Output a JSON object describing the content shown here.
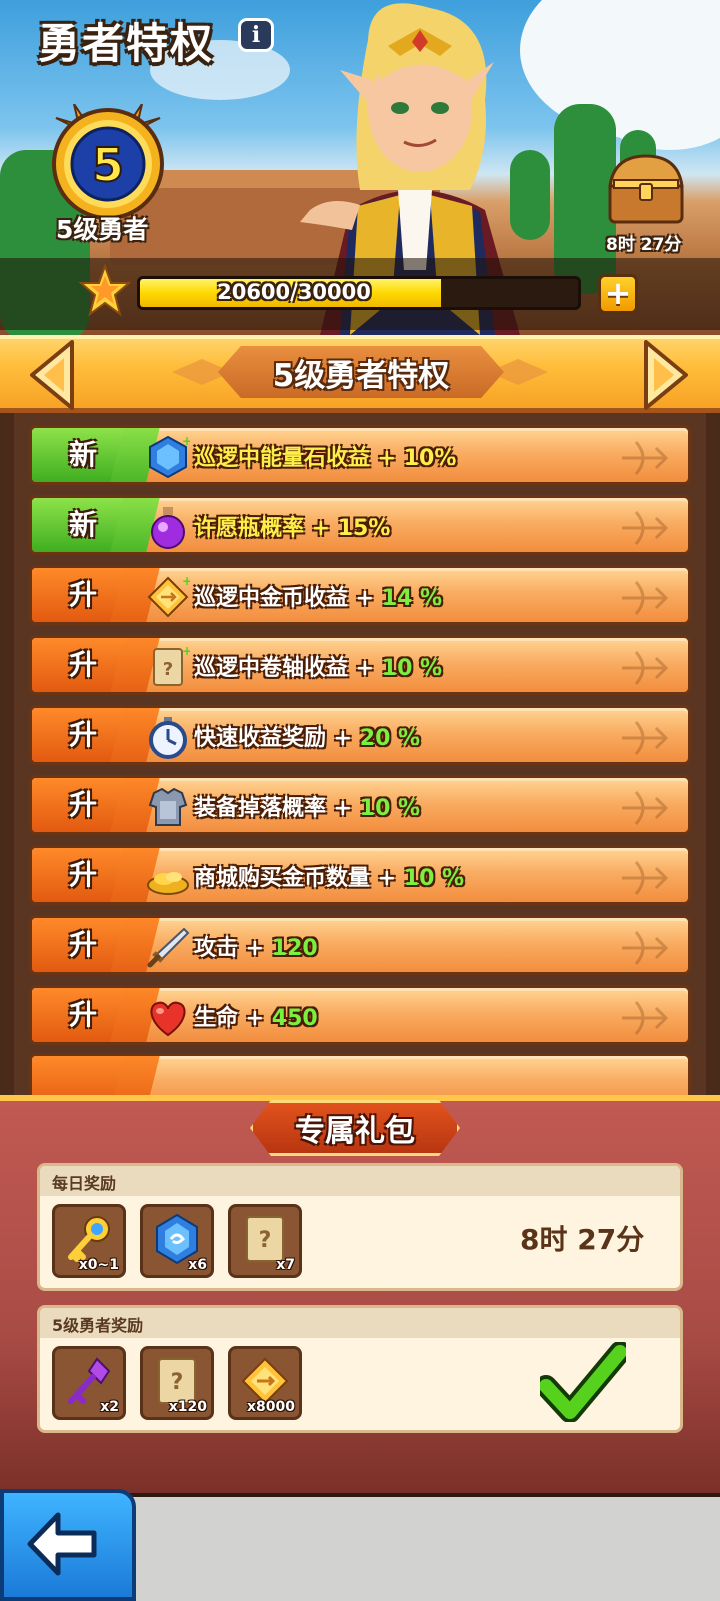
{
  "header": {
    "title": "勇者特权",
    "info_icon": "info-icon",
    "level_number": "5",
    "level_caption": "5级勇者",
    "chest_timer": "8时 27分",
    "xp_text": "20600/30000",
    "xp_current": 20600,
    "xp_max": 30000,
    "plus_label": "+"
  },
  "banner": {
    "title": "5级勇者特权",
    "left_arrow_icon": "arrow-left-icon",
    "right_arrow_icon": "arrow-right-icon"
  },
  "privileges": [
    {
      "tag": "新",
      "kind": "new",
      "icon": "energy-stone-icon",
      "text": "巡逻中能量石收益 + 10%",
      "value": ""
    },
    {
      "tag": "新",
      "kind": "new",
      "icon": "wish-bottle-icon",
      "text": "许愿瓶概率 + 15%",
      "value": ""
    },
    {
      "tag": "升",
      "kind": "up",
      "icon": "gold-coin-icon",
      "text": "巡逻中金币收益 + ",
      "value": "14 %"
    },
    {
      "tag": "升",
      "kind": "up",
      "icon": "scroll-icon",
      "text": "巡逻中卷轴收益 + ",
      "value": "10 %"
    },
    {
      "tag": "升",
      "kind": "up",
      "icon": "stopwatch-icon",
      "text": "快速收益奖励 + ",
      "value": "20 %"
    },
    {
      "tag": "升",
      "kind": "up",
      "icon": "armor-icon",
      "text": "装备掉落概率 + ",
      "value": "10 %"
    },
    {
      "tag": "升",
      "kind": "up",
      "icon": "gold-pile-icon",
      "text": "商城购买金币数量 + ",
      "value": "10 %"
    },
    {
      "tag": "升",
      "kind": "up",
      "icon": "sword-icon",
      "text": "攻击 + ",
      "value": "120"
    },
    {
      "tag": "升",
      "kind": "up",
      "icon": "heart-icon",
      "text": "生命 + ",
      "value": "450"
    }
  ],
  "gift": {
    "title": "专属礼包",
    "daily": {
      "label": "每日奖励",
      "timer": "8时 27分",
      "items": [
        {
          "icon": "gold-key-icon",
          "count": "x0~1"
        },
        {
          "icon": "energy-stone-icon",
          "count": "x6"
        },
        {
          "icon": "scroll-icon",
          "count": "x7"
        }
      ]
    },
    "level": {
      "label": "5级勇者奖励",
      "claimed_icon": "checkmark-icon",
      "items": [
        {
          "icon": "purple-key-icon",
          "count": "x2"
        },
        {
          "icon": "scroll-icon",
          "count": "x120"
        },
        {
          "icon": "gold-coin-icon",
          "count": "x8000"
        }
      ]
    }
  },
  "nav": {
    "back_icon": "back-arrow-icon"
  },
  "colors": {
    "banner": "#ffbd3a",
    "row_new": "#3fae20",
    "row_up": "#e25a10",
    "value_green": "#7cf040",
    "gift_bg": "#a94b45",
    "back_button": "#1b7ad8"
  }
}
